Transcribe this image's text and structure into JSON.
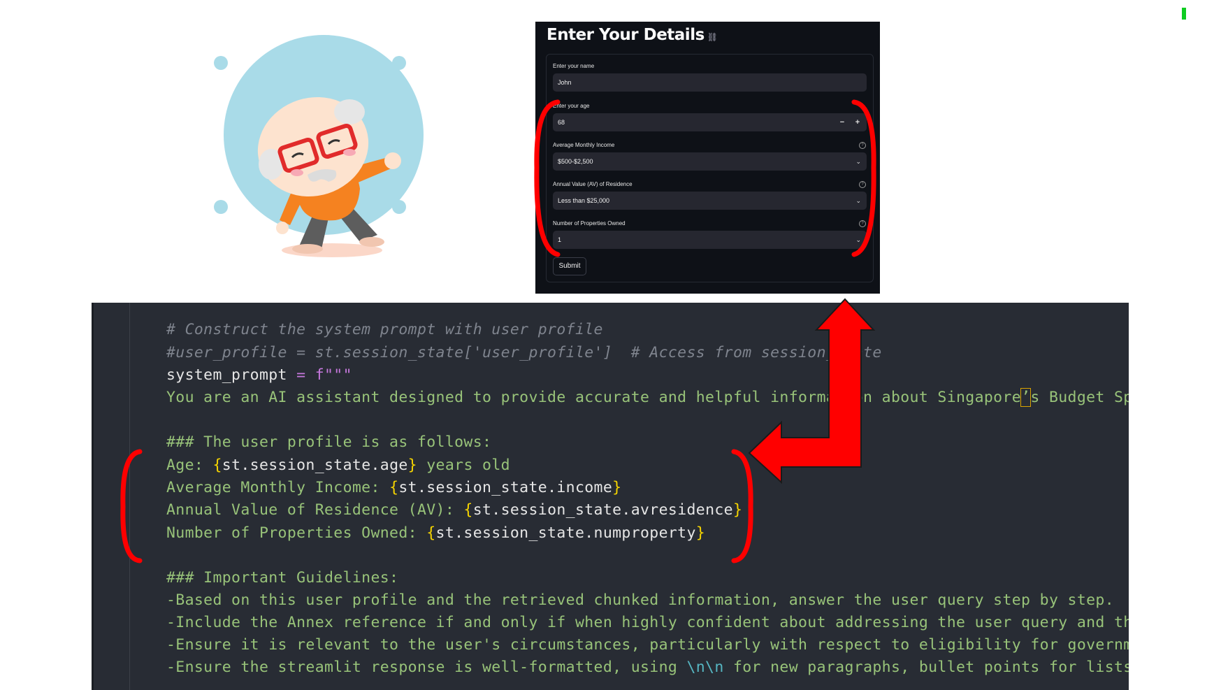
{
  "form": {
    "title": "Enter Your Details",
    "link_icon": "link-icon",
    "name_label": "Enter your name",
    "name_value": "John",
    "age_label": "Enter your age",
    "age_value": "68",
    "age_minus": "−",
    "age_plus": "+",
    "income_label": "Average Monthly Income",
    "income_value": "$500-$2,500",
    "av_label": "Annual Value (AV) of Residence",
    "av_value": "Less than $25,000",
    "props_label": "Number of Properties Owned",
    "props_value": "1",
    "help_icon": "?",
    "submit_label": "Submit"
  },
  "code": {
    "line1": "# Construct the system prompt with user profile",
    "line2": "#user_profile = st.session_state['user_profile']  # Access from session_state",
    "line3_var": "system_prompt",
    "line3_op": " = ",
    "line3_str": "f\"\"\"",
    "line4_a": "You are an AI assistant designed to provide accurate and helpful information about Singapore",
    "line4_cursor": "’",
    "line4_b": "s Budget Speech",
    "line6": "### The user profile is as follows:",
    "line7_label": "Age: ",
    "line7_expr": "st.session_state.age",
    "line7_tail": " years old",
    "line8_label": "Average Monthly Income: ",
    "line8_expr": "st.session_state.income",
    "line9_label": "Annual Value of Residence (AV): ",
    "line9_expr": "st.session_state.avresidence",
    "line10_label": "Number of Properties Owned: ",
    "line10_expr": "st.session_state.numproperty",
    "brace_open": "{",
    "brace_close": "}",
    "line12": "### Important Guidelines:",
    "line13": "-Based on this user profile and the retrieved chunked information, answer the user query step by step.",
    "line14": "-Include the Annex reference if and only if when highly confident about addressing the user query and the",
    "line15": "-Ensure it is relevant to the user's circumstances, particularly with respect to eligibility for government",
    "line16_a": "-Ensure the streamlit response is well-formatted, using ",
    "line16_esc": "\\n\\n",
    "line16_b": " for new paragraphs, bullet points for lists,"
  },
  "colors": {
    "annotation_red": "#ff0000",
    "code_bg": "#282c34",
    "form_bg": "#0e1117"
  }
}
